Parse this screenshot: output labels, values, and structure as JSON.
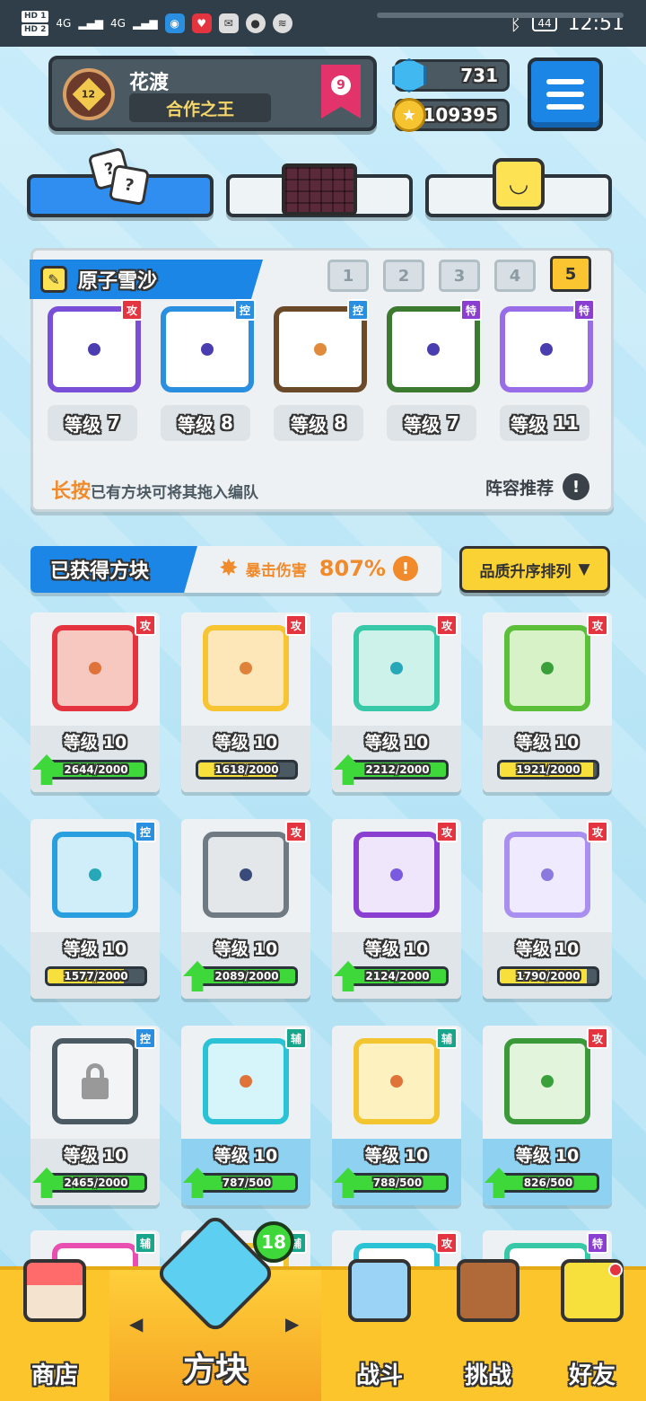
{
  "status_bar": {
    "sim1": "HD 1",
    "sim2": "HD 2",
    "net1": "4G",
    "net2": "4G",
    "battery": "44",
    "time": "12:51"
  },
  "profile": {
    "name": "花渡",
    "title": "合作之王",
    "avatar_level": "12",
    "rank": "9"
  },
  "currency": {
    "gems": "731",
    "coins": "109395"
  },
  "lineup": {
    "deck_name": "原子雪沙",
    "deck_tabs": [
      "1",
      "2",
      "3",
      "4",
      "5"
    ],
    "active_deck": "5",
    "cards": [
      {
        "type": "攻",
        "level_label": "等级",
        "level": "7",
        "frame": "#7a4fd8",
        "dot": "#4a3db0"
      },
      {
        "type": "控",
        "level_label": "等级",
        "level": "8",
        "frame": "#2a8fe0",
        "dot": "#4a3db0"
      },
      {
        "type": "控",
        "level_label": "等级",
        "level": "8",
        "frame": "#6b4a2a",
        "dot": "#e08a3a"
      },
      {
        "type": "特",
        "level_label": "等级",
        "level": "7",
        "frame": "#3b7a2f",
        "dot": "#4a3db0"
      },
      {
        "type": "特",
        "level_label": "等级",
        "level": "11",
        "frame": "#9a6de8",
        "dot": "#4a3db0"
      }
    ],
    "hint_highlight": "长按",
    "hint_text": "已有方块可将其拖入编队",
    "recommend": "阵容推荐"
  },
  "owned": {
    "label": "已获得方块",
    "crit_label": "暴击伤害",
    "crit_value": "807%",
    "sort_label": "品质升序排列"
  },
  "blocks": [
    {
      "type": "攻",
      "level_label": "等级",
      "level": "10",
      "progress": "2644/2000",
      "fill": 1.0,
      "upgradable": true,
      "frame": "#e3343f",
      "dot": "#e0733a",
      "bg": "#f7c8c0"
    },
    {
      "type": "攻",
      "level_label": "等级",
      "level": "10",
      "progress": "1618/2000",
      "fill": 0.81,
      "upgradable": false,
      "frame": "#f7c531",
      "dot": "#e0833a",
      "bg": "#fde6b8"
    },
    {
      "type": "攻",
      "level_label": "等级",
      "level": "10",
      "progress": "2212/2000",
      "fill": 1.0,
      "upgradable": true,
      "frame": "#37c8a8",
      "dot": "#27a8b8",
      "bg": "#cdf2ea"
    },
    {
      "type": "攻",
      "level_label": "等级",
      "level": "10",
      "progress": "1921/2000",
      "fill": 0.96,
      "upgradable": false,
      "frame": "#5cbf3a",
      "dot": "#3aa03a",
      "bg": "#d8f2c8"
    },
    {
      "type": "控",
      "level_label": "等级",
      "level": "10",
      "progress": "1577/2000",
      "fill": 0.79,
      "upgradable": false,
      "frame": "#2a9fe0",
      "dot": "#27a8b8",
      "bg": "#cfeefa"
    },
    {
      "type": "攻",
      "level_label": "等级",
      "level": "10",
      "progress": "2089/2000",
      "fill": 1.0,
      "upgradable": true,
      "frame": "#6f7a82",
      "dot": "#3a4a7a",
      "bg": "#e3e7ea"
    },
    {
      "type": "攻",
      "level_label": "等级",
      "level": "10",
      "progress": "2124/2000",
      "fill": 1.0,
      "upgradable": true,
      "frame": "#8a3fd1",
      "dot": "#7a5ae0",
      "bg": "#efe6fb"
    },
    {
      "type": "攻",
      "level_label": "等级",
      "level": "10",
      "progress": "1790/2000",
      "fill": 0.9,
      "upgradable": false,
      "frame": "#a98ff0",
      "dot": "#8a7ae0",
      "bg": "#efeafd"
    },
    {
      "type": "控",
      "level_label": "等级",
      "level": "10",
      "progress": "2465/2000",
      "fill": 1.0,
      "upgradable": true,
      "frame": "#4b5962",
      "dot": "#333",
      "bg": "#f2f4f6",
      "locked": true
    },
    {
      "type": "辅",
      "level_label": "等级",
      "level": "10",
      "progress": "787/500",
      "fill": 1.0,
      "upgradable": true,
      "frame": "#2ac3d6",
      "dot": "#e0733a",
      "bg": "#d6f5fa",
      "blue": true
    },
    {
      "type": "辅",
      "level_label": "等级",
      "level": "10",
      "progress": "788/500",
      "fill": 1.0,
      "upgradable": true,
      "frame": "#f2c531",
      "dot": "#e0733a",
      "bg": "#fdf1c0",
      "blue": true
    },
    {
      "type": "攻",
      "level_label": "等级",
      "level": "10",
      "progress": "826/500",
      "fill": 1.0,
      "upgradable": true,
      "frame": "#3a9a3a",
      "dot": "#3aa03a",
      "bg": "#e2f4dc",
      "blue": true
    }
  ],
  "partial_row": [
    {
      "type": "辅",
      "frame": "#e84fb0"
    },
    {
      "type": "辅",
      "frame": "#f2c531"
    },
    {
      "type": "攻",
      "frame": "#2ac3d6"
    },
    {
      "type": "特",
      "frame": "#37c8a8"
    }
  ],
  "nav": {
    "shop": "商店",
    "blocks": "方块",
    "battle": "战斗",
    "challenge": "挑战",
    "friends": "好友",
    "block_count": "18"
  }
}
